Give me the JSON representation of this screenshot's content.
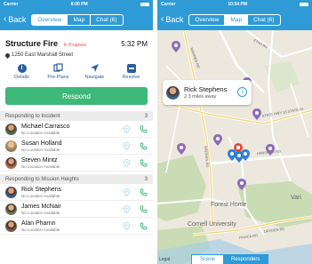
{
  "left": {
    "status": {
      "carrier": "Carrier",
      "time": "8:00 PM"
    },
    "nav": {
      "back_label": "Back",
      "tabs": [
        "Overview",
        "Map",
        "Chat (6)"
      ],
      "active_tab": 0
    },
    "incident": {
      "title": "Structure Fire",
      "status": "In Progress",
      "time": "5:32 PM",
      "address": "1250 East Marshall Street"
    },
    "actions": [
      {
        "label": "Details",
        "icon": "info-icon"
      },
      {
        "label": "Pre-Plans",
        "icon": "preplans-icon"
      },
      {
        "label": "Navigate",
        "icon": "navigate-arrow-icon"
      },
      {
        "label": "Resolve",
        "icon": "resolve-icon"
      }
    ],
    "respond_label": "Respond",
    "sections": [
      {
        "title": "Responding to Incident",
        "count": "3",
        "people": [
          {
            "name": "Michael Carrasco",
            "location": "No Location Available"
          },
          {
            "name": "Susan Holland",
            "location": "No Location Available"
          },
          {
            "name": "Steven Mintz",
            "location": "No Location Available"
          }
        ]
      },
      {
        "title": "Responding to Mission Heights",
        "count": "3",
        "people": [
          {
            "name": "Rick Stephens",
            "location": "No Location Available"
          },
          {
            "name": "James McNair",
            "location": "No Location Available"
          },
          {
            "name": "Alan Pharnn",
            "location": "No Location Available"
          }
        ]
      }
    ]
  },
  "right": {
    "status": {
      "carrier": "Carrier",
      "time": "10:54 PM"
    },
    "nav": {
      "back_label": "Back",
      "tabs": [
        "Overview",
        "Map",
        "Chat (6)"
      ],
      "active_tab": 1
    },
    "callout": {
      "name": "Rick Stephens",
      "distance": "2.3 miles away"
    },
    "map_labels": {
      "street_a": "STATE HWY 13 STATE HI",
      "street_b": "HANSHAW RD",
      "street_c": "WARREN RD",
      "street_d": "ETNA RD",
      "street_e": "ITHACA RD",
      "street_f": "DRYDEN RD",
      "area_a": "Forest Home",
      "area_b": "Cornell University",
      "area_c": "Vari"
    },
    "bottom_tabs": [
      "Scene",
      "Responders"
    ],
    "active_bottom_tab": 1,
    "legal": "Legal"
  },
  "colors": {
    "brand_blue": "#2e9bd6",
    "respond_green": "#3cb878",
    "status_red": "#d9534f",
    "marker_purple": "#8e6cb8"
  }
}
